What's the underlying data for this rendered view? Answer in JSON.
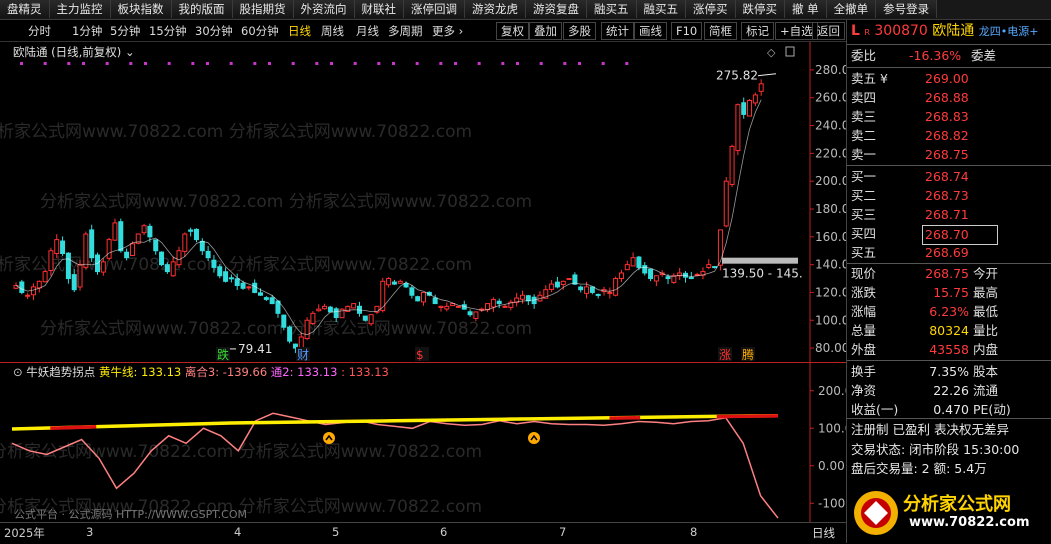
{
  "toolbar": [
    "盘精灵",
    "主力监控",
    "板块指数",
    "我的版面",
    "股指期货",
    "外资流向",
    "财联社",
    "涨停回调",
    "游资龙虎",
    "游资复盘",
    "融买五",
    "融买五",
    "涨停买",
    "跌停买",
    "撤 单",
    "全撤单",
    "参号登录"
  ],
  "periods": [
    "分时",
    "1分钟",
    "5分钟",
    "15分钟",
    "30分钟",
    "60分钟",
    "日线",
    "周线",
    "月线",
    "多周期",
    "更多 ›"
  ],
  "active_period": "日线",
  "right_buttons": [
    "复权",
    "叠加",
    "多股",
    "统计",
    "画线",
    "F10",
    "简框",
    "标记",
    "+自选",
    "返回"
  ],
  "chart": {
    "title": "欧陆通 (日线,前复权) ⌄",
    "y_labels": [
      "280.00",
      "260.00",
      "240.00",
      "220.00",
      "200.00",
      "180.00",
      "160.00",
      "140.00",
      "120.00",
      "100.00",
      "80.00"
    ],
    "high_label": "275.82",
    "low_label": "79.41",
    "range_label": "139.50 - 145.",
    "markers": {
      "die": "跌",
      "cai": "财",
      "s": "$",
      "zhang": "涨",
      "teng": "腾"
    },
    "watermark": "分析家公式网www.70822.com 分析家公式网www.70822.com"
  },
  "chart_data": {
    "type": "candlestick",
    "title": "欧陆通 (日线,前复权)",
    "ylim": [
      70,
      290
    ],
    "high": 275.82,
    "low": 79.41,
    "gap_range": "139.50 - 145.",
    "closes": [
      125,
      120,
      118,
      124,
      128,
      135,
      150,
      158,
      148,
      130,
      122,
      140,
      162,
      145,
      135,
      142,
      158,
      170,
      150,
      145,
      155,
      162,
      168,
      160,
      150,
      140,
      135,
      142,
      150,
      162,
      164,
      158,
      150,
      145,
      138,
      132,
      128,
      130,
      125,
      123,
      124,
      120,
      118,
      115,
      112,
      105,
      95,
      85,
      80,
      88,
      100,
      105,
      108,
      110,
      106,
      102,
      108,
      110,
      112,
      105,
      100,
      104,
      110,
      128,
      130,
      126,
      128,
      124,
      118,
      114,
      120,
      118,
      112,
      110,
      110,
      112,
      110,
      108,
      104,
      106,
      108,
      112,
      115,
      112,
      110,
      113,
      116,
      118,
      114,
      112,
      118,
      122,
      126,
      124,
      128,
      130,
      126,
      122,
      124,
      120,
      118,
      122,
      120,
      130,
      134,
      140,
      145,
      138,
      134,
      130,
      132,
      134,
      130,
      132,
      134,
      131,
      130,
      133,
      135,
      140,
      138,
      165,
      200,
      225,
      255,
      248,
      258,
      262,
      270
    ],
    "volume_ma": [
      {
        "name": "成交量均线",
        "values": []
      }
    ]
  },
  "indicator": {
    "name": "牛妖趋势拐点",
    "yellow_label": "黄牛线:",
    "yellow_value": "133.13",
    "lihe_label": "离合3:",
    "lihe_value": "-139.66",
    "tong_label": "通2:",
    "tong_value": "133.13",
    "tong_value2": "133.13",
    "y_labels": [
      "200.00",
      "100.00",
      "0.00",
      "-100.00"
    ],
    "footer_left": "公式平台 · 公式源码 HTTP://WWW.GSPT.COM"
  },
  "indicator_data": {
    "type": "line",
    "ylim": [
      -150,
      250
    ],
    "series": [
      {
        "name": "黄牛线",
        "values": [
          98,
          100,
          102,
          104,
          106,
          108,
          110,
          112,
          114,
          115,
          116,
          117,
          118,
          119,
          120,
          121,
          122,
          123,
          124,
          125,
          126,
          127,
          128,
          129,
          130,
          131,
          132,
          133,
          133.13
        ]
      },
      {
        "name": "离合3",
        "values": [
          60,
          40,
          30,
          50,
          70,
          20,
          -60,
          -20,
          40,
          80,
          60,
          100,
          80,
          40,
          120,
          140,
          130,
          120,
          110,
          115,
          120,
          110,
          105,
          100,
          118,
          112,
          108,
          110,
          120,
          112,
          118,
          112,
          110,
          110,
          108,
          112,
          118,
          116,
          112,
          118,
          120,
          128,
          60,
          -80,
          -139.66
        ]
      }
    ]
  },
  "xaxis": {
    "labels": [
      "2025年",
      "3",
      "4",
      "5",
      "6",
      "7",
      "8"
    ],
    "period": "日线"
  },
  "quote": {
    "code": "300870",
    "name": "欧陆通",
    "tags": "龙四•电源+",
    "weibi_label": "委比",
    "weibi": "-16.36%",
    "weicha_label": "委差",
    "asks": [
      {
        "label": "卖五 ¥",
        "price": "269.00"
      },
      {
        "label": "卖四",
        "price": "268.88"
      },
      {
        "label": "卖三",
        "price": "268.83"
      },
      {
        "label": "卖二",
        "price": "268.82"
      },
      {
        "label": "卖一",
        "price": "268.75"
      }
    ],
    "bids": [
      {
        "label": "买一",
        "price": "268.74"
      },
      {
        "label": "买二",
        "price": "268.73"
      },
      {
        "label": "买三",
        "price": "268.71"
      },
      {
        "label": "买四",
        "price": "268.70"
      },
      {
        "label": "买五",
        "price": "268.69"
      }
    ],
    "stats": [
      {
        "l1": "现价",
        "v1": "268.75",
        "c1": "red",
        "l2": "今开"
      },
      {
        "l1": "涨跌",
        "v1": "15.75",
        "c1": "red",
        "l2": "最高"
      },
      {
        "l1": "涨幅",
        "v1": "6.23%",
        "c1": "red",
        "l2": "最低"
      },
      {
        "l1": "总量",
        "v1": "80324",
        "c1": "yel",
        "l2": "量比"
      },
      {
        "l1": "外盘",
        "v1": "43558",
        "c1": "red",
        "l2": "内盘"
      }
    ],
    "stats2": [
      {
        "l1": "换手",
        "v1": "7.35%",
        "l2": "股本"
      },
      {
        "l1": "净资",
        "v1": "22.26",
        "l2": "流通"
      },
      {
        "l1": "收益(一)",
        "v1": "0.470",
        "l2": "PE(动)"
      }
    ],
    "reg": "注册制 已盈利 表决权无差异",
    "trade_status": "交易状态: 闭市阶段 15:30:00",
    "after_hours": "盘后交易量: 2  额: 5.4万",
    "logo_text": "分析家公式网",
    "logo_url": "www.70822.com"
  },
  "colors": {
    "up": "#ff3030",
    "down": "#33dddd",
    "ma": "#ffffff",
    "yellow": "#ffee00",
    "pink": "#ff8080"
  }
}
